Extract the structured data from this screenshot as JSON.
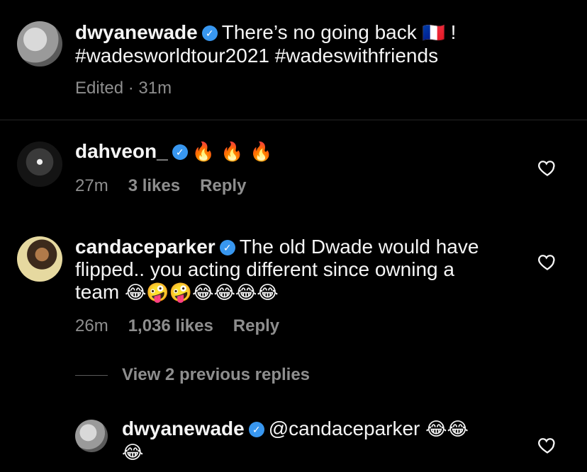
{
  "caption": {
    "username": "dwyanewade",
    "text_line1": "There’s no going back",
    "flag": "🇫🇷",
    "text_end": " !",
    "text_line2": "#wadesworldtour2021 #wadeswithfriends",
    "edited_label": "Edited · 31m"
  },
  "comments": [
    {
      "username": "dahveon_",
      "text": "",
      "emojis": "🔥 🔥 🔥",
      "time": "27m",
      "likes": "3 likes",
      "reply": "Reply"
    },
    {
      "username": "candaceparker",
      "text_line1": "The old Dwade would have",
      "text_line2": "flipped.. you acting different since owning a",
      "text_line3": "team",
      "emojis": "😂🤪🤪😂😂😂😂",
      "time": "26m",
      "likes": "1,036 likes",
      "reply": "Reply"
    }
  ],
  "view_replies": "View 2 previous replies",
  "reply": {
    "username": "dwyanewade",
    "mention": "@candaceparker",
    "emojis_line1": "😂😂",
    "emojis_line2": "😂"
  },
  "icons": {
    "verified": "verified-badge-icon",
    "heart": "heart-outline-icon"
  },
  "colors": {
    "background": "#000000",
    "text": "#f5f5f5",
    "meta": "#8e8e8e",
    "verified": "#3897f0"
  }
}
